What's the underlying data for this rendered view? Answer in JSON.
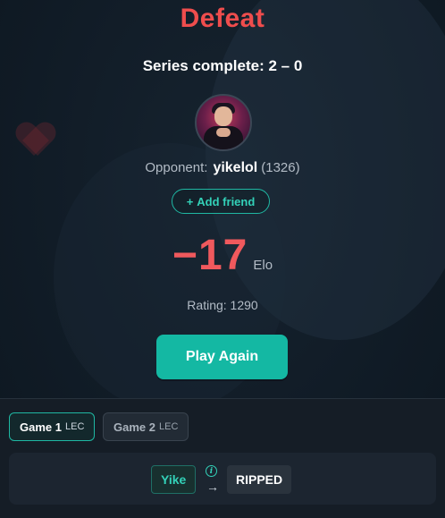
{
  "result": {
    "title": "Defeat",
    "series_text": "Series complete: 2 – 0"
  },
  "opponent": {
    "label": "Opponent:",
    "name": "yikelol",
    "elo": "(1326)",
    "add_friend_icon": "plus-icon",
    "add_friend_label": "Add friend"
  },
  "elo_change": {
    "value": "−17",
    "unit": "Elo"
  },
  "rating": {
    "text": "Rating: 1290"
  },
  "actions": {
    "play_again_label": "Play Again"
  },
  "games": {
    "tabs": [
      {
        "label": "Game 1",
        "tag": "LEC",
        "active": true
      },
      {
        "label": "Game 2",
        "tag": "LEC",
        "active": false
      }
    ],
    "detail": {
      "from": "Yike",
      "info_icon": "info-icon",
      "arrow": "→",
      "to": "RIPPED"
    }
  },
  "colors": {
    "defeat": "#ef4d4d",
    "accent": "#14b8a3",
    "background": "#0f1a24"
  }
}
